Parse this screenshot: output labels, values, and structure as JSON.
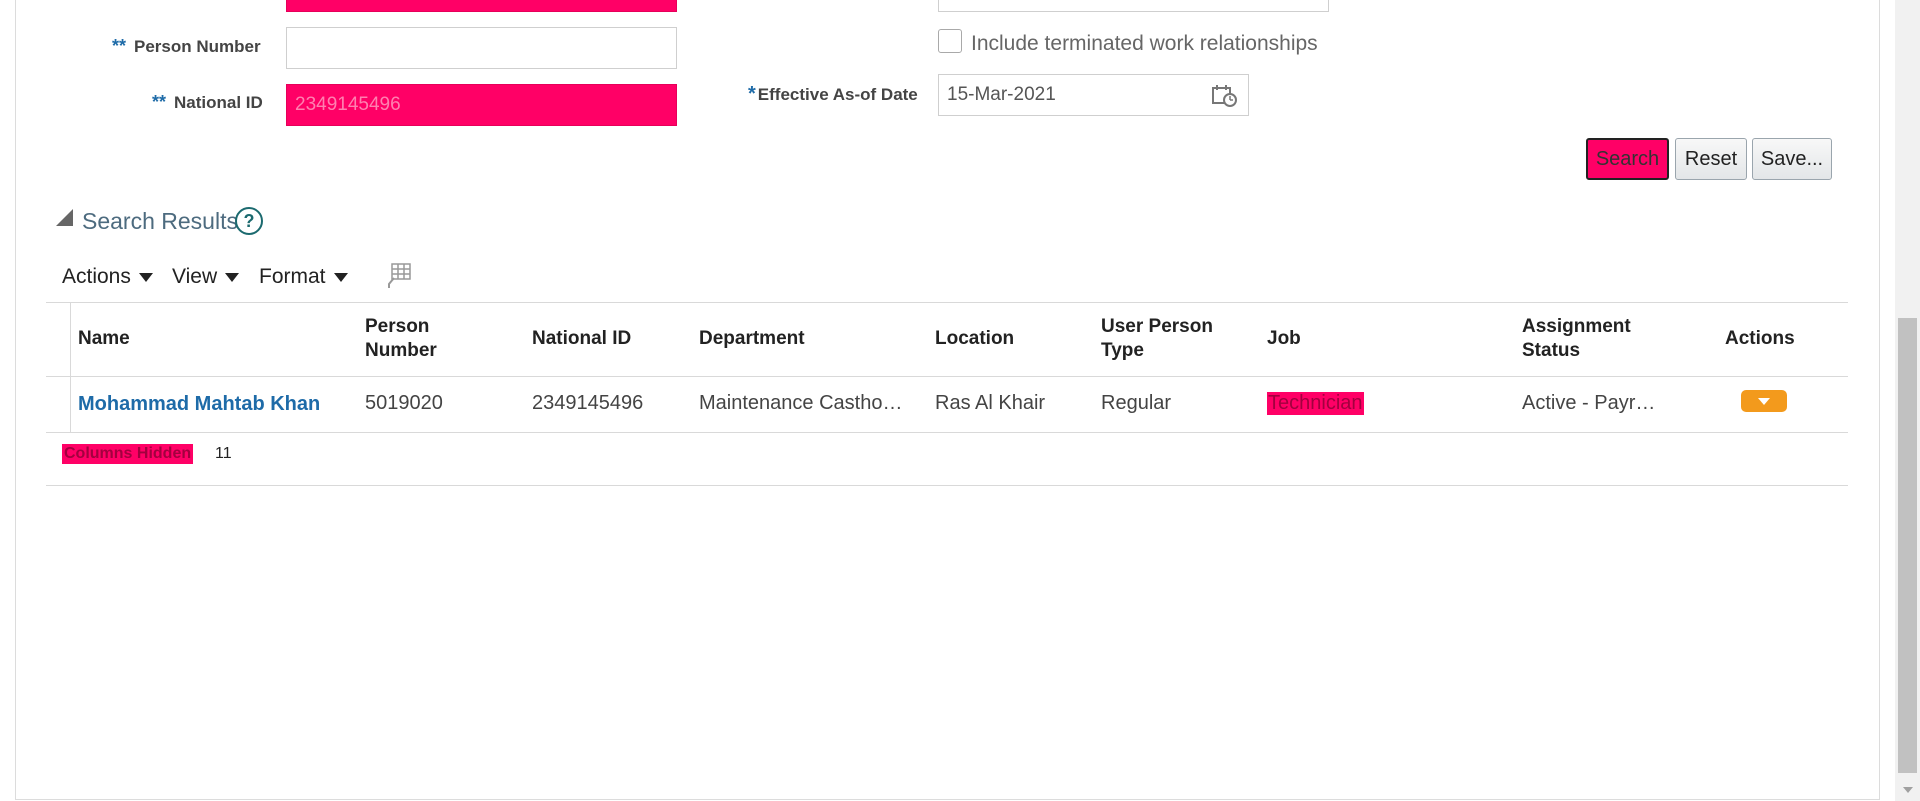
{
  "form": {
    "person_number_label": "Person Number",
    "person_number_req": "**",
    "person_number_value": "",
    "national_id_label": "National ID",
    "national_id_req": "**",
    "national_id_value": "2349145496",
    "include_terminated_label": "Include terminated work relationships",
    "effective_date_req": "*",
    "effective_date_label": "Effective As-of Date",
    "effective_date_value": "15-Mar-2021"
  },
  "buttons": {
    "search": "Search",
    "reset": "Reset",
    "save": "Save..."
  },
  "results": {
    "title": "Search Results",
    "help": "?",
    "menus": {
      "actions": "Actions",
      "view": "View",
      "format": "Format"
    },
    "columns": {
      "name": "Name",
      "person_number": "Person Number",
      "national_id": "National ID",
      "department": "Department",
      "location": "Location",
      "user_person_type": "User Person Type",
      "job": "Job",
      "assignment_status": "Assignment Status",
      "actions": "Actions"
    },
    "rows": [
      {
        "name": "Mohammad Mahtab Khan",
        "person_number": "5019020",
        "national_id": "2349145496",
        "department": "Maintenance Castho…",
        "location": "Ras Al Khair",
        "user_person_type": "Regular",
        "job": "Technician",
        "assignment_status": "Active - Payr…"
      }
    ],
    "columns_hidden_label": "Columns Hidden",
    "columns_hidden_count": "11"
  },
  "colors": {
    "highlight": "#ff0066",
    "link": "#1e6ba8",
    "action_button": "#f39a1c"
  }
}
